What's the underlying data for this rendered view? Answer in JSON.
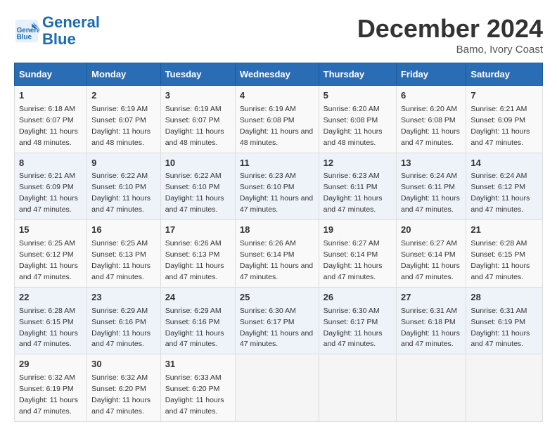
{
  "header": {
    "logo_line1": "General",
    "logo_line2": "Blue",
    "month": "December 2024",
    "location": "Bamo, Ivory Coast"
  },
  "days_of_week": [
    "Sunday",
    "Monday",
    "Tuesday",
    "Wednesday",
    "Thursday",
    "Friday",
    "Saturday"
  ],
  "weeks": [
    [
      {
        "day": "1",
        "sunrise": "6:18 AM",
        "sunset": "6:07 PM",
        "daylight": "11 hours and 48 minutes."
      },
      {
        "day": "2",
        "sunrise": "6:19 AM",
        "sunset": "6:07 PM",
        "daylight": "11 hours and 48 minutes."
      },
      {
        "day": "3",
        "sunrise": "6:19 AM",
        "sunset": "6:07 PM",
        "daylight": "11 hours and 48 minutes."
      },
      {
        "day": "4",
        "sunrise": "6:19 AM",
        "sunset": "6:08 PM",
        "daylight": "11 hours and 48 minutes."
      },
      {
        "day": "5",
        "sunrise": "6:20 AM",
        "sunset": "6:08 PM",
        "daylight": "11 hours and 48 minutes."
      },
      {
        "day": "6",
        "sunrise": "6:20 AM",
        "sunset": "6:08 PM",
        "daylight": "11 hours and 47 minutes."
      },
      {
        "day": "7",
        "sunrise": "6:21 AM",
        "sunset": "6:09 PM",
        "daylight": "11 hours and 47 minutes."
      }
    ],
    [
      {
        "day": "8",
        "sunrise": "6:21 AM",
        "sunset": "6:09 PM",
        "daylight": "11 hours and 47 minutes."
      },
      {
        "day": "9",
        "sunrise": "6:22 AM",
        "sunset": "6:10 PM",
        "daylight": "11 hours and 47 minutes."
      },
      {
        "day": "10",
        "sunrise": "6:22 AM",
        "sunset": "6:10 PM",
        "daylight": "11 hours and 47 minutes."
      },
      {
        "day": "11",
        "sunrise": "6:23 AM",
        "sunset": "6:10 PM",
        "daylight": "11 hours and 47 minutes."
      },
      {
        "day": "12",
        "sunrise": "6:23 AM",
        "sunset": "6:11 PM",
        "daylight": "11 hours and 47 minutes."
      },
      {
        "day": "13",
        "sunrise": "6:24 AM",
        "sunset": "6:11 PM",
        "daylight": "11 hours and 47 minutes."
      },
      {
        "day": "14",
        "sunrise": "6:24 AM",
        "sunset": "6:12 PM",
        "daylight": "11 hours and 47 minutes."
      }
    ],
    [
      {
        "day": "15",
        "sunrise": "6:25 AM",
        "sunset": "6:12 PM",
        "daylight": "11 hours and 47 minutes."
      },
      {
        "day": "16",
        "sunrise": "6:25 AM",
        "sunset": "6:13 PM",
        "daylight": "11 hours and 47 minutes."
      },
      {
        "day": "17",
        "sunrise": "6:26 AM",
        "sunset": "6:13 PM",
        "daylight": "11 hours and 47 minutes."
      },
      {
        "day": "18",
        "sunrise": "6:26 AM",
        "sunset": "6:14 PM",
        "daylight": "11 hours and 47 minutes."
      },
      {
        "day": "19",
        "sunrise": "6:27 AM",
        "sunset": "6:14 PM",
        "daylight": "11 hours and 47 minutes."
      },
      {
        "day": "20",
        "sunrise": "6:27 AM",
        "sunset": "6:14 PM",
        "daylight": "11 hours and 47 minutes."
      },
      {
        "day": "21",
        "sunrise": "6:28 AM",
        "sunset": "6:15 PM",
        "daylight": "11 hours and 47 minutes."
      }
    ],
    [
      {
        "day": "22",
        "sunrise": "6:28 AM",
        "sunset": "6:15 PM",
        "daylight": "11 hours and 47 minutes."
      },
      {
        "day": "23",
        "sunrise": "6:29 AM",
        "sunset": "6:16 PM",
        "daylight": "11 hours and 47 minutes."
      },
      {
        "day": "24",
        "sunrise": "6:29 AM",
        "sunset": "6:16 PM",
        "daylight": "11 hours and 47 minutes."
      },
      {
        "day": "25",
        "sunrise": "6:30 AM",
        "sunset": "6:17 PM",
        "daylight": "11 hours and 47 minutes."
      },
      {
        "day": "26",
        "sunrise": "6:30 AM",
        "sunset": "6:17 PM",
        "daylight": "11 hours and 47 minutes."
      },
      {
        "day": "27",
        "sunrise": "6:31 AM",
        "sunset": "6:18 PM",
        "daylight": "11 hours and 47 minutes."
      },
      {
        "day": "28",
        "sunrise": "6:31 AM",
        "sunset": "6:19 PM",
        "daylight": "11 hours and 47 minutes."
      }
    ],
    [
      {
        "day": "29",
        "sunrise": "6:32 AM",
        "sunset": "6:19 PM",
        "daylight": "11 hours and 47 minutes."
      },
      {
        "day": "30",
        "sunrise": "6:32 AM",
        "sunset": "6:20 PM",
        "daylight": "11 hours and 47 minutes."
      },
      {
        "day": "31",
        "sunrise": "6:33 AM",
        "sunset": "6:20 PM",
        "daylight": "11 hours and 47 minutes."
      },
      null,
      null,
      null,
      null
    ]
  ]
}
